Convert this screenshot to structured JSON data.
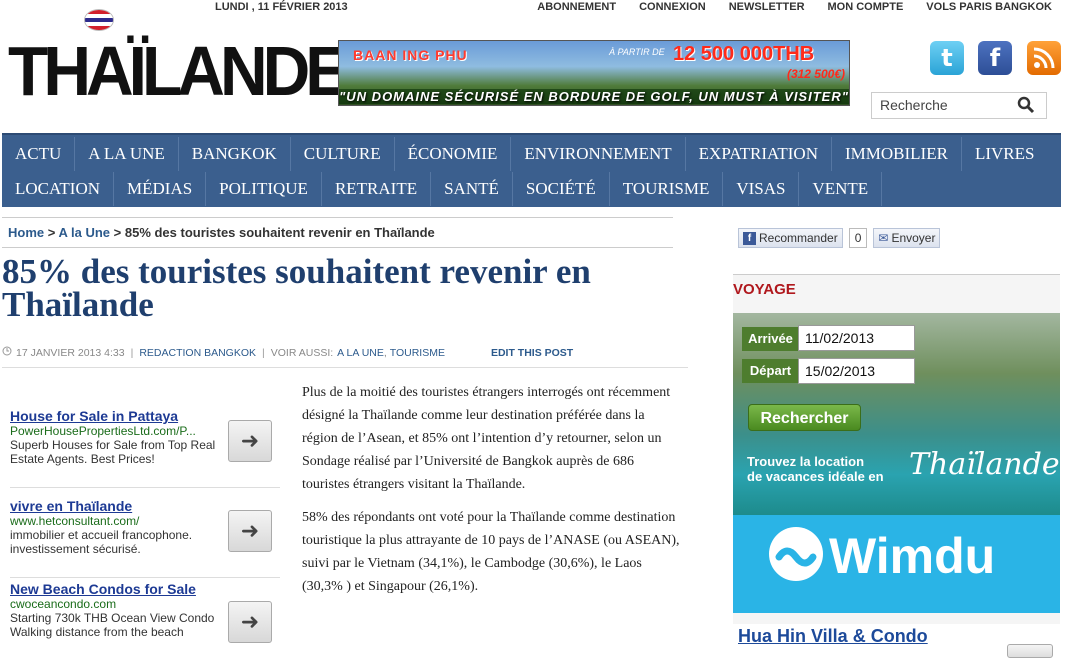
{
  "header": {
    "date": "LUNDI , 11 FÉVRIER 2013",
    "topnav": [
      "ABONNEMENT",
      "CONNEXION",
      "NEWSLETTER",
      "MON COMPTE",
      "VOLS PARIS BANGKOK"
    ],
    "logo": "THAÏLANDEFR",
    "search_placeholder": "Recherche"
  },
  "banner": {
    "brand": "BAAN ING PHU",
    "price_prefix": "À PARTIR DE",
    "price": "12 500 000THB",
    "price_eur": "(312 500€)",
    "tagline": "\"UN DOMAINE SÉCURISÉ EN BORDURE DE GOLF, UN MUST À VISITER\""
  },
  "nav": {
    "row1": [
      "ACTU",
      "A LA UNE",
      "BANGKOK",
      "CULTURE",
      "ÉCONOMIE",
      "ENVIRONNEMENT",
      "EXPATRIATION",
      "IMMOBILIER",
      "LIVRES"
    ],
    "row2": [
      "LOCATION",
      "MÉDIAS",
      "POLITIQUE",
      "RETRAITE",
      "SANTÉ",
      "SOCIÉTÉ",
      "TOURISME",
      "VISAS",
      "VENTE"
    ]
  },
  "breadcrumb": {
    "home": "Home",
    "sep": ">",
    "section": "A la Une",
    "current": "85% des touristes souhaitent revenir en Thaïlande"
  },
  "article": {
    "title": "85% des touristes souhaitent revenir en Thaïlande",
    "date": "17 JANVIER 2013 4:33",
    "author": "REDACTION BANGKOK",
    "see_also": "VOIR AUSSI:",
    "tag1": "A LA UNE",
    "tag2": "TOURISME",
    "edit": "EDIT THIS POST",
    "p1": "Plus de la moitié des touristes étrangers interrogés ont récemment désigné la Thaïlande comme leur destination préférée dans la région de l’Asean, et 85% ont l’intention d’y retourner, selon un Sondage réalisé par  l’Université de Bangkok  auprès de 686 touristes étrangers visitant la Thaïlande.",
    "p2": "58% des répondants ont voté pour la Thaïlande comme destination touristique la plus attrayante de 10 pays de l’ANASE (ou ASEAN), suivi par le Vietnam (34,1%), le Cambodge (30,6%), le Laos (30,3% ) et Singapour (26,1%)."
  },
  "ads": [
    {
      "title": "House for Sale in Pattaya",
      "url": "PowerHousePropertiesLtd.com/P...",
      "desc": "Superb Houses for Sale from Top Real Estate Agents. Best Prices!"
    },
    {
      "title": "vivre en Thaïlande",
      "url": "www.hetconsultant.com/",
      "desc": "immobilier et accueil francophone. investissement sécurisé."
    },
    {
      "title": "New Beach Condos for Sale",
      "url": "cwoceancondo.com",
      "desc": "Starting 730k THB Ocean View Condo Walking distance from the beach"
    }
  ],
  "share": {
    "recommend": "Recommander",
    "count": "0",
    "send": "Envoyer"
  },
  "voyage": {
    "heading": "VOYAGE",
    "arrival_label": "Arrivée",
    "arrival": "11/02/2013",
    "departure_label": "Départ",
    "departure": "15/02/2013",
    "search_button": "Rechercher",
    "promo_line1": "Trouvez la location",
    "promo_line2": "de vacances idéale en",
    "promo_script": "Thaïlande",
    "wimdu": "Wimdu"
  },
  "hua_hin": "Hua Hin Villa & Condo"
}
